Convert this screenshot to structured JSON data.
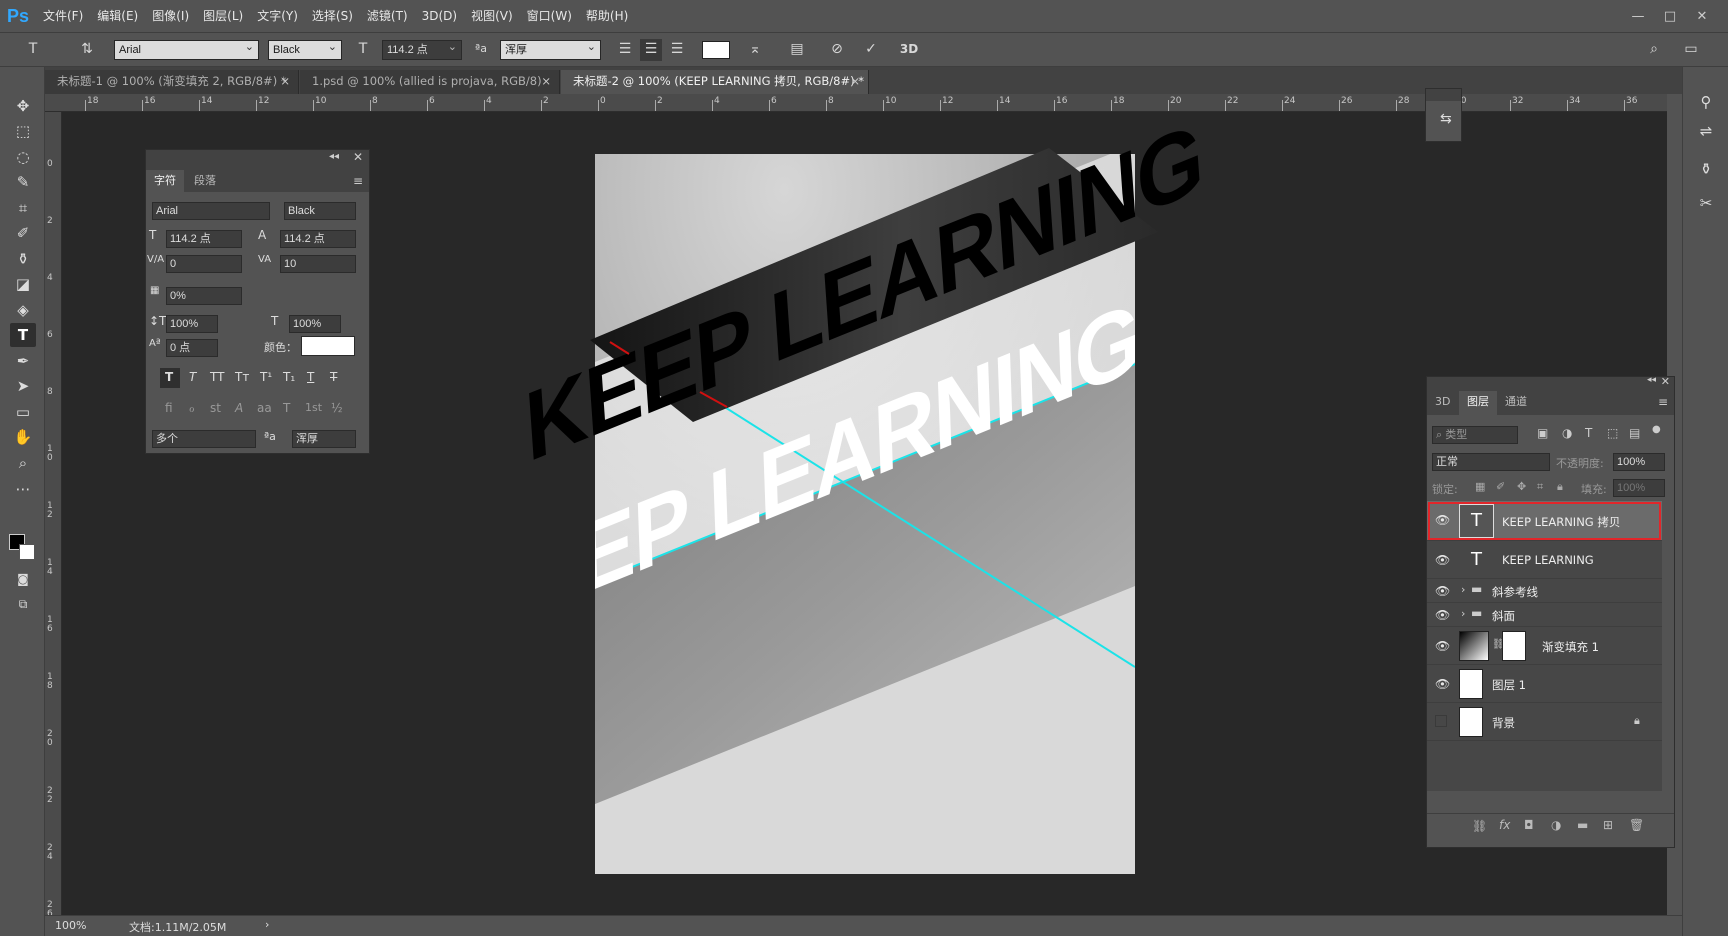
{
  "app": {
    "logo": "Ps"
  },
  "menu": [
    "文件(F)",
    "编辑(E)",
    "图像(I)",
    "图层(L)",
    "文字(Y)",
    "选择(S)",
    "滤镜(T)",
    "3D(D)",
    "视图(V)",
    "窗口(W)",
    "帮助(H)"
  ],
  "window_controls": {
    "minimize": "—",
    "maximize": "□",
    "close": "✕"
  },
  "options": {
    "font_family": "Arial",
    "font_style": "Black",
    "font_size": "114.2 点",
    "antialias": "浑厚",
    "aa_label": "ªa",
    "label_3d": "3D"
  },
  "tabs": [
    {
      "label": "未标题-1 @ 100% (渐变填充 2, RGB/8#) *",
      "close": "×"
    },
    {
      "label": "1.psd @ 100% (allied is projava, RGB/8)",
      "close": "×"
    },
    {
      "label": "未标题-2 @ 100% (KEEP  LEARNING 拷贝, RGB/8#) *",
      "close": "×"
    }
  ],
  "ruler_h": [
    "18",
    "16",
    "14",
    "12",
    "10",
    "8",
    "6",
    "4",
    "2",
    "0",
    "2",
    "4",
    "6",
    "8",
    "10",
    "12",
    "14",
    "16",
    "18",
    "20",
    "22",
    "24",
    "26",
    "28",
    "30",
    "32",
    "34",
    "36"
  ],
  "ruler_v": [
    "0",
    "2",
    "4",
    "6",
    "8",
    "1 0",
    "1 2",
    "1 4",
    "1 6",
    "1 8",
    "2 0",
    "2 2",
    "2 4",
    "2 6"
  ],
  "char_panel": {
    "tab_char": "字符",
    "tab_para": "段落",
    "font_family": "Arial",
    "font_style": "Black",
    "size": "114.2 点",
    "leading": "114.2 点",
    "kerning": "0",
    "tracking": "10",
    "tsume": "0%",
    "vscale": "100%",
    "hscale": "100%",
    "baseline": "0 点",
    "color_label": "颜色：",
    "style_buttons": [
      "T",
      "T",
      "TT",
      "Tт",
      "T¹",
      "T₁",
      "T",
      "T"
    ],
    "ot_buttons": [
      "fi",
      "ℴ",
      "st",
      "A",
      "aa",
      "T",
      "1st",
      "½"
    ],
    "language": "多个",
    "antialias": "浑厚",
    "aa_label": "ªa"
  },
  "canvas": {
    "text_black": "KEEP LEARNING",
    "text_white": "KEEP LEARNING"
  },
  "layers_panel": {
    "tabs": [
      "3D",
      "图层",
      "通道"
    ],
    "filter_placeholder": "类型",
    "blend_mode": "正常",
    "opacity_label": "不透明度:",
    "opacity": "100%",
    "lock_label": "锁定:",
    "fill_label": "填充:",
    "fill": "100%",
    "layers": [
      {
        "name": "KEEP LEARNING 拷贝",
        "kind": "text",
        "selected": true
      },
      {
        "name": "KEEP LEARNING",
        "kind": "text",
        "selected": false
      },
      {
        "name": "斜参考线",
        "kind": "group",
        "selected": false
      },
      {
        "name": "斜面",
        "kind": "group",
        "selected": false
      },
      {
        "name": "渐变填充 1",
        "kind": "gradient",
        "selected": false
      },
      {
        "name": "图层 1",
        "kind": "pixel",
        "selected": false
      },
      {
        "name": "背景",
        "kind": "background",
        "selected": false
      }
    ]
  },
  "status": {
    "zoom": "100%",
    "doc": "文档:1.11M/2.05M",
    "arrow": "›"
  }
}
